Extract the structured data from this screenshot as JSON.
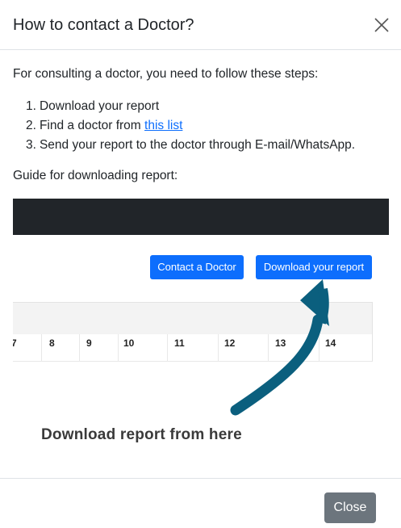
{
  "modal": {
    "title": "How to contact a Doctor?",
    "close_icon": "close-icon"
  },
  "body": {
    "intro": "For consulting a doctor, you need to follow these steps:",
    "steps": [
      {
        "num": "1.",
        "text": "Download your report"
      },
      {
        "num": "2.",
        "text": "Find a doctor from ",
        "link": "this list"
      },
      {
        "num": "3.",
        "text": "Send your report to the doctor through E-mail/WhatsApp."
      }
    ],
    "guide_label": "Guide for downloading report:"
  },
  "guide_image": {
    "contact_button": "Contact a Doctor",
    "download_button": "Download your report",
    "table_columns": [
      "7",
      "8",
      "9",
      "10",
      "11",
      "12",
      "13",
      "14"
    ],
    "caption": "Download report from here",
    "arrow_color": "#0b5f7e",
    "navbar_color": "#212529",
    "button_color": "#0d6efd"
  },
  "footer": {
    "close_label": "Close"
  }
}
